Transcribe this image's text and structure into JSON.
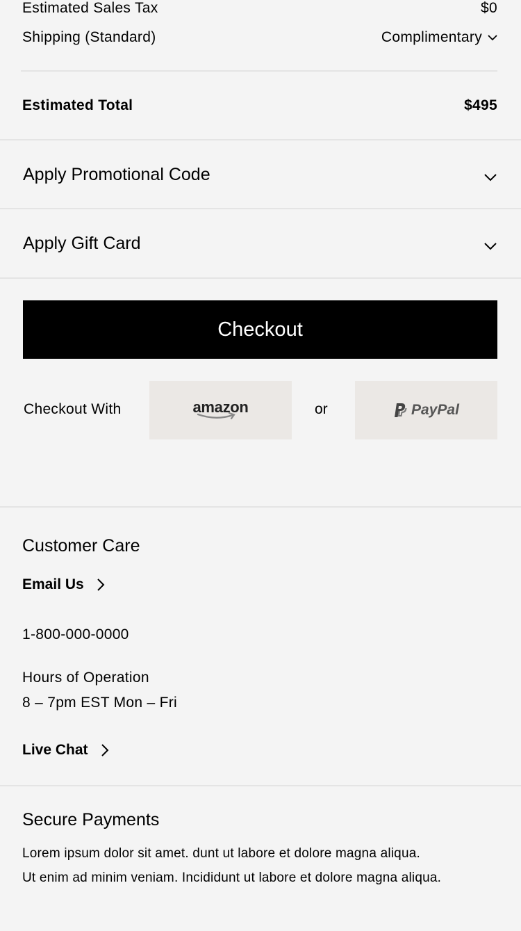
{
  "summary": {
    "tax_label": "Estimated Sales Tax",
    "tax_value": "$0",
    "shipping_label": "Shipping (Standard)",
    "shipping_value": "Complimentary",
    "total_label": "Estimated Total",
    "total_value": "$495"
  },
  "accordions": {
    "promo_label": "Apply Promotional Code",
    "giftcard_label": "Apply Gift Card"
  },
  "checkout": {
    "button_label": "Checkout",
    "with_label": "Checkout With",
    "or_label": "or",
    "amazon_label": "amazon",
    "paypal_label": "PayPal"
  },
  "customer_care": {
    "title": "Customer Care",
    "email_label": "Email Us",
    "phone": "1-800-000-0000",
    "hours_label": "Hours of Operation",
    "hours_value": "8 – 7pm EST Mon – Fri",
    "chat_label": "Live Chat"
  },
  "secure_payments": {
    "title": "Secure Payments",
    "line1": "Lorem ipsum dolor sit amet. dunt ut labore et dolore magna aliqua.",
    "line2": "Ut enim ad minim veniam. Incididunt ut labore et dolore magna aliqua."
  },
  "icons": {
    "chevron_down": "chevron-down-icon",
    "chevron_right": "chevron-right-icon",
    "paypal_mark": "paypal-icon",
    "amazon_smile": "amazon-smile-icon"
  },
  "colors": {
    "background": "#f4f4f4",
    "divider": "#e4e4e4",
    "primary_button": "#000000",
    "payment_button": "#ebe8e5"
  }
}
